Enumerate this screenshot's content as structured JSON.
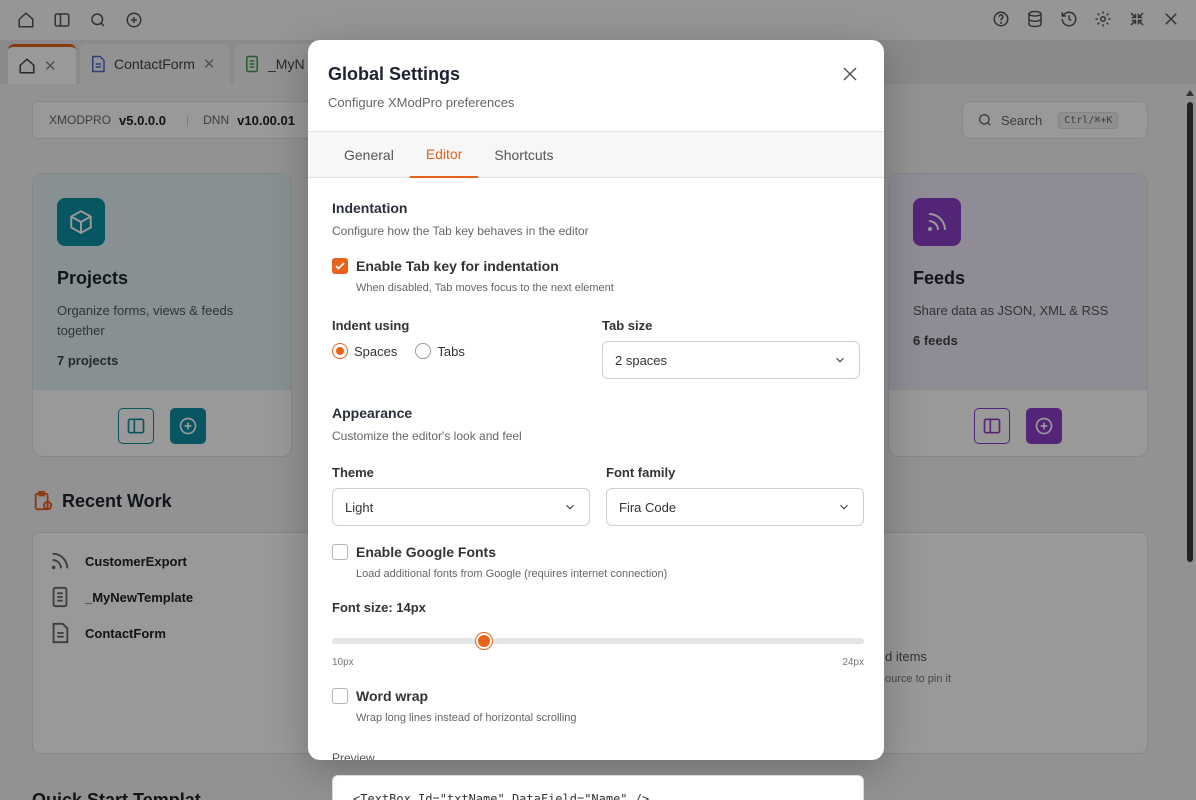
{
  "tabs": [
    {
      "label": ""
    },
    {
      "label": "ContactForm"
    },
    {
      "label": "_MyN"
    }
  ],
  "infobar": {
    "product": "XMODPRO",
    "version": "v5.0.0.0",
    "platform": "DNN",
    "platform_version": "v10.00.01"
  },
  "search": {
    "label": "Search",
    "shortcut": "Ctrl/⌘+K"
  },
  "cards": [
    {
      "title": "Projects",
      "desc": "Organize forms, views & feeds together",
      "count": "7 projects",
      "color": "#0e8fa3"
    },
    {
      "title": "Feeds",
      "desc": "Share data as JSON, XML & RSS",
      "count": "6 feeds",
      "color": "#8a3fc7"
    }
  ],
  "recent": {
    "title": "Recent Work",
    "items": [
      {
        "name": "CustomerExport",
        "icon": "rss-icon"
      },
      {
        "name": "_MyNewTemplate",
        "icon": "template-icon"
      },
      {
        "name": "ContactForm",
        "icon": "form-icon"
      }
    ],
    "pinned_hint_1": "d items",
    "pinned_hint_2": "ource to pin it"
  },
  "quickstart": {
    "title": "Quick Start Templat"
  },
  "modal": {
    "title": "Global Settings",
    "subtitle": "Configure XModPro preferences",
    "tabs": [
      "General",
      "Editor",
      "Shortcuts"
    ],
    "active_tab": "Editor",
    "indentation": {
      "title": "Indentation",
      "desc": "Configure how the Tab key behaves in the editor",
      "enable_tab_label": "Enable Tab key for indentation",
      "enable_tab_hint": "When disabled, Tab moves focus to the next element",
      "enable_tab_checked": true,
      "indent_using_label": "Indent using",
      "spaces_label": "Spaces",
      "tabs_label": "Tabs",
      "indent_selected": "Spaces",
      "tab_size_label": "Tab size",
      "tab_size_value": "2 spaces"
    },
    "appearance": {
      "title": "Appearance",
      "desc": "Customize the editor's look and feel",
      "theme_label": "Theme",
      "theme_value": "Light",
      "font_family_label": "Font family",
      "font_family_value": "Fira Code",
      "google_fonts_label": "Enable Google Fonts",
      "google_fonts_hint": "Load additional fonts from Google (requires internet connection)",
      "google_fonts_checked": false,
      "font_size_label": "Font size: 14px",
      "font_size_min": "10px",
      "font_size_max": "24px",
      "font_size_value": 14,
      "word_wrap_label": "Word wrap",
      "word_wrap_hint": "Wrap long lines instead of horizontal scrolling",
      "word_wrap_checked": false,
      "preview_label": "Preview",
      "preview_code": "<TextBox Id=\"txtName\" DataField=\"Name\" />"
    }
  },
  "colors": {
    "accent": "#e8621c",
    "projects": "#0e8fa3",
    "feeds": "#8a3fc7"
  }
}
